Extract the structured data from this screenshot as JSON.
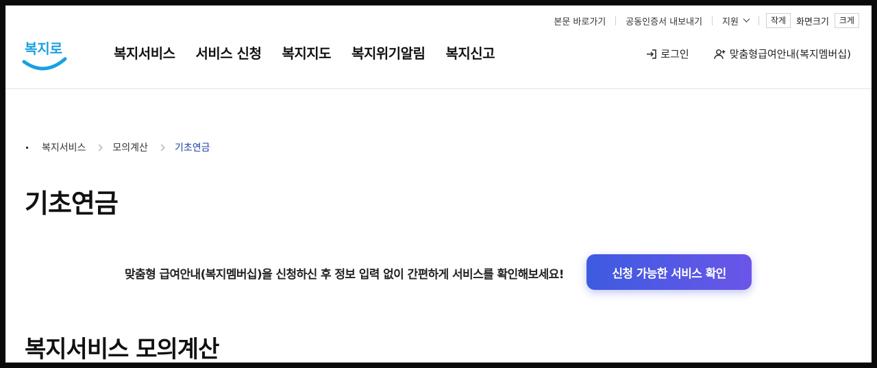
{
  "utility": {
    "skip_link": "본문 바로가기",
    "cert_export": "공동인증서 내보내기",
    "support": "지원",
    "size_small": "작게",
    "size_label": "화면크기",
    "size_large": "크게"
  },
  "header": {
    "logo_text": "복지로",
    "nav": [
      "복지서비스",
      "서비스 신청",
      "복지지도",
      "복지위기알림",
      "복지신고"
    ],
    "login": "로그인",
    "membership": "맞춤형급여안내(복지멤버십)"
  },
  "breadcrumb": [
    "복지서비스",
    "모의계산",
    "기초연금"
  ],
  "page_title": "기초연금",
  "promo": {
    "text": "맞춤형 급여안내(복지멤버십)을 신청하신 후 정보 입력 없이 간편하게 서비스를 확인해보세요!",
    "button": "신청 가능한 서비스 확인"
  },
  "section_title": "복지서비스 모의계산",
  "colors": {
    "accent": "#3d5be0",
    "logo_blue": "#1aa0e0",
    "breadcrumb_current": "#1f3fa8"
  }
}
